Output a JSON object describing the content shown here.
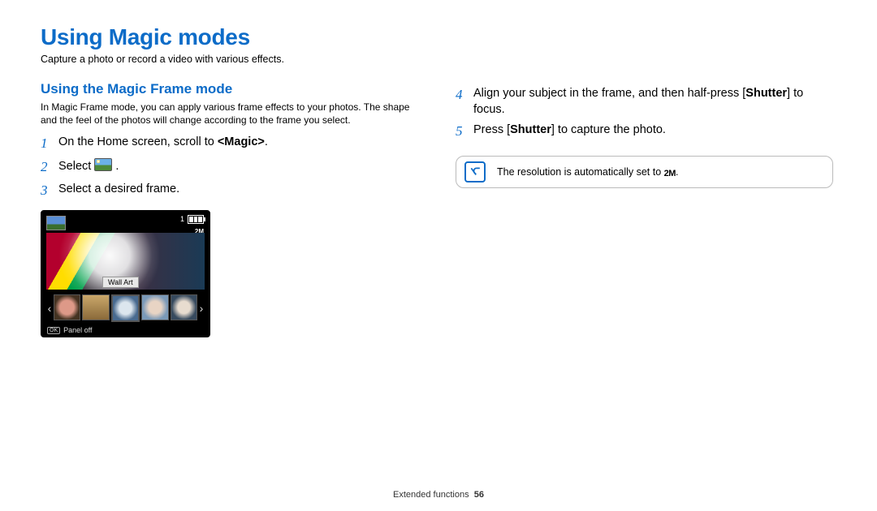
{
  "page_title": "Using Magic modes",
  "page_intro": "Capture a photo or record a video with various effects.",
  "left": {
    "heading": "Using the Magic Frame mode",
    "intro": "In Magic Frame mode, you can apply various frame effects to your photos. The shape and the feel of the photos will change according to the frame you select.",
    "steps": {
      "s1_pre": "On the Home screen, scroll to ",
      "s1_bold": "<Magic>",
      "s1_post": ".",
      "s2_pre": "Select ",
      "s2_post": ".",
      "s3": "Select a desired frame."
    },
    "screen": {
      "selected_frame_label": "Wall Art",
      "panel_label": "Panel off",
      "ok_label": "OK",
      "shots_remaining": "1",
      "resolution_label": "2M"
    }
  },
  "right": {
    "steps": {
      "s4_pre": "Align your subject in the frame, and then half-press [",
      "s4_bold": "Shutter",
      "s4_post": "] to focus.",
      "s5_pre": "Press [",
      "s5_bold": "Shutter",
      "s5_post": "] to capture the photo."
    },
    "note_pre": "The resolution is automatically set to ",
    "note_res": "2M",
    "note_post": "."
  },
  "footer": {
    "section": "Extended functions",
    "page_number": "56"
  }
}
